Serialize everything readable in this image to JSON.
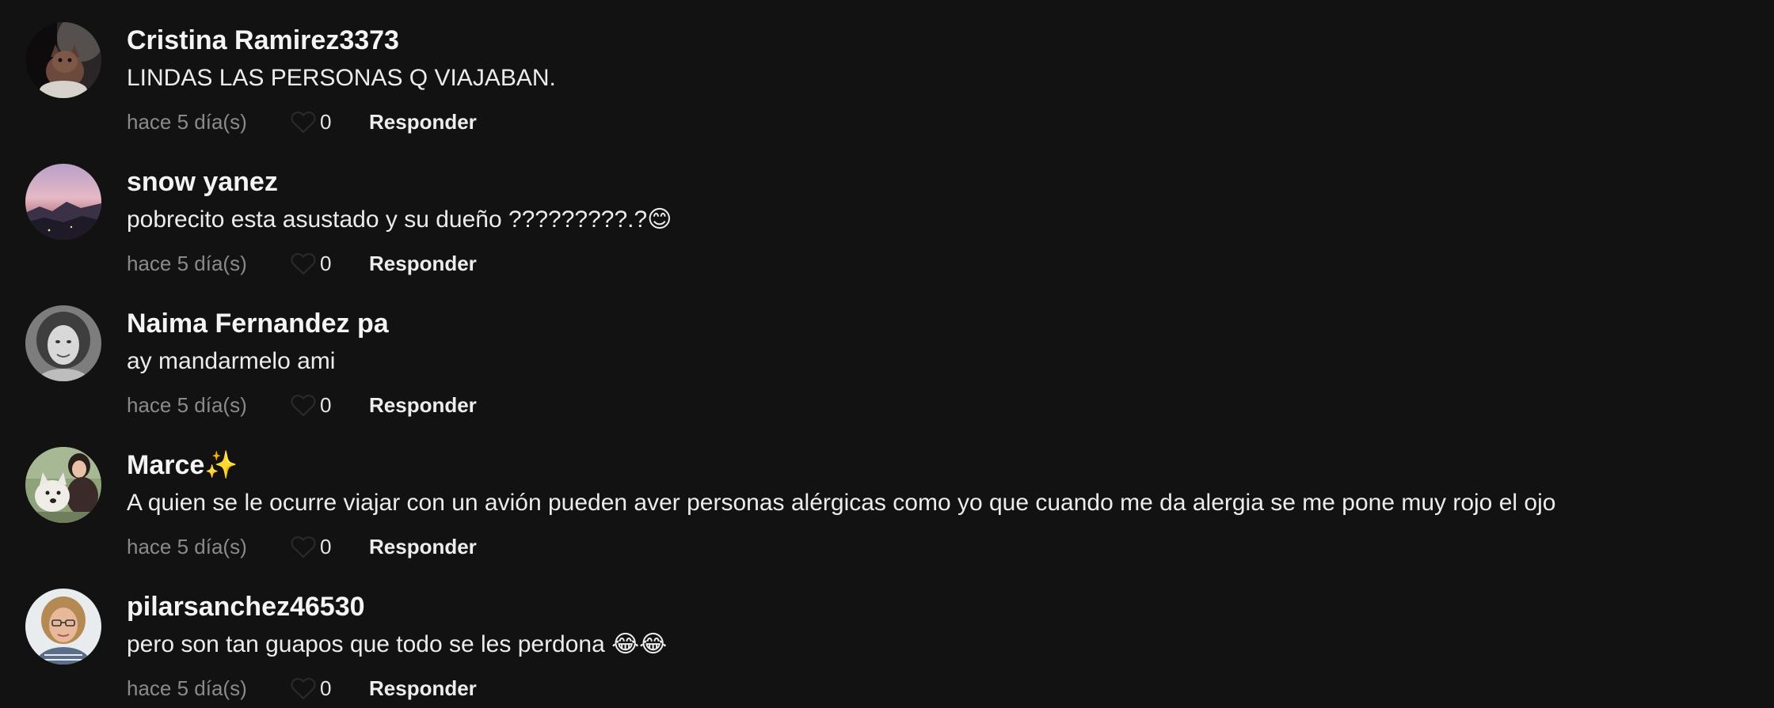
{
  "comments": [
    {
      "username": "Cristina Ramirez3373",
      "text": "LINDAS LAS PERSONAS Q VIAJABAN.",
      "time": "hace 5 día(s)",
      "likes": "0",
      "reply_label": "Responder"
    },
    {
      "username": "snow yanez",
      "text": "pobrecito esta asustado y su dueño ?????????.?😊",
      "time": "hace 5 día(s)",
      "likes": "0",
      "reply_label": "Responder"
    },
    {
      "username": "Naima Fernandez pa",
      "text": "ay mandarmelo ami",
      "time": "hace 5 día(s)",
      "likes": "0",
      "reply_label": "Responder"
    },
    {
      "username": "Marce✨",
      "text": "A quien se le ocurre viajar con un avión pueden aver personas alérgicas como yo que cuando me da alergia se me pone muy rojo el ojo",
      "time": "hace 5 día(s)",
      "likes": "0",
      "reply_label": "Responder"
    },
    {
      "username": "pilarsanchez46530",
      "text": "pero son tan guapos que todo se les perdona 😂😂",
      "time": "hace 5 día(s)",
      "likes": "0",
      "reply_label": "Responder"
    }
  ],
  "icons": {
    "like": "heart-outline-icon"
  },
  "colors": {
    "background": "#121212",
    "username": "#f4f4f4",
    "text": "#ececec",
    "timestamp": "#8a8a8a",
    "heart_outline": "#2a2a2a"
  }
}
